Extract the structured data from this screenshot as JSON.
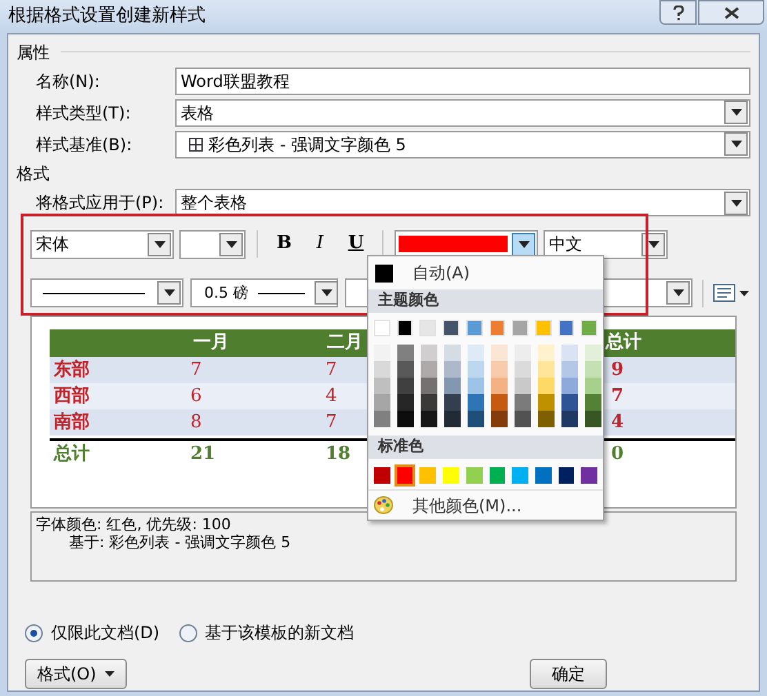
{
  "window": {
    "title": "根据格式设置创建新样式"
  },
  "properties": {
    "heading": "属性",
    "fields": [
      {
        "label": "名称(N):",
        "value": "Word联盟教程",
        "kind": "text"
      },
      {
        "label": "样式类型(T):",
        "value": "表格",
        "kind": "dropdown"
      },
      {
        "label": "样式基准(B):",
        "value": "彩色列表 - 强调文字颜色 5",
        "kind": "table_dropdown"
      }
    ]
  },
  "format": {
    "heading": "格式",
    "apply_label": "将格式应用于(P):",
    "apply_value": "整个表格",
    "font": "宋体",
    "style_buttons": [
      {
        "label": "B",
        "kind": "bold"
      },
      {
        "label": "I",
        "kind": "italic"
      },
      {
        "label": "U",
        "kind": "underline"
      }
    ],
    "font_color": {
      "color": "#ff0000"
    },
    "script": "中文",
    "line_weight": "0.5 磅"
  },
  "preview": {
    "columns": [
      "一月",
      "二月",
      "总计"
    ],
    "rows": [
      {
        "label": "东部",
        "values": [
          "7",
          "7",
          "9"
        ],
        "kind": "data"
      },
      {
        "label": "西部",
        "values": [
          "6",
          "4",
          "7"
        ],
        "kind": "data"
      },
      {
        "label": "南部",
        "values": [
          "8",
          "7",
          "4"
        ],
        "kind": "data"
      },
      {
        "label": "总计",
        "values": [
          "21",
          "18",
          "0"
        ],
        "kind": "total"
      }
    ]
  },
  "description": [
    "字体颜色: 红色, 优先级: 100",
    "基于: 彩色列表 - 强调文字颜色 5"
  ],
  "scope": [
    {
      "label": "仅限此文档(D)",
      "selected": true
    },
    {
      "label": "基于该模板的新文档",
      "selected": false
    }
  ],
  "buttons": {
    "format": "格式(O)",
    "ok": "确定"
  },
  "color_menu": {
    "auto_label": "自动(A)",
    "theme_heading": "主题颜色",
    "theme_colors": [
      {
        "color": "#ffffff",
        "selected": false,
        "shades": [
          {
            "color": "#f2f2f2"
          },
          {
            "color": "#d9d9d9"
          },
          {
            "color": "#bfbfbf"
          },
          {
            "color": "#a6a6a6"
          },
          {
            "color": "#808080"
          }
        ]
      },
      {
        "color": "#000000",
        "selected": false,
        "shades": [
          {
            "color": "#808080"
          },
          {
            "color": "#595959"
          },
          {
            "color": "#404040"
          },
          {
            "color": "#262626"
          },
          {
            "color": "#0d0d0d"
          }
        ]
      },
      {
        "color": "#e7e6e6",
        "selected": false,
        "shades": [
          {
            "color": "#d0cece"
          },
          {
            "color": "#aeaaaa"
          },
          {
            "color": "#757171"
          },
          {
            "color": "#3b3838"
          },
          {
            "color": "#171616"
          }
        ]
      },
      {
        "color": "#44546a",
        "selected": false,
        "shades": [
          {
            "color": "#d6dce4"
          },
          {
            "color": "#adb9ca"
          },
          {
            "color": "#8497b0"
          },
          {
            "color": "#333f4f"
          },
          {
            "color": "#222a35"
          }
        ]
      },
      {
        "color": "#5b9bd5",
        "selected": false,
        "shades": [
          {
            "color": "#deebf6"
          },
          {
            "color": "#bdd7ee"
          },
          {
            "color": "#9dc3e6"
          },
          {
            "color": "#2e75b5"
          },
          {
            "color": "#1f4e79"
          }
        ]
      },
      {
        "color": "#ed7d31",
        "selected": false,
        "shades": [
          {
            "color": "#fbe5d5"
          },
          {
            "color": "#f7cbac"
          },
          {
            "color": "#f4b183"
          },
          {
            "color": "#c55a11"
          },
          {
            "color": "#843c0b"
          }
        ]
      },
      {
        "color": "#a5a5a5",
        "selected": false,
        "shades": [
          {
            "color": "#ededed"
          },
          {
            "color": "#dbdbdb"
          },
          {
            "color": "#c9c9c9"
          },
          {
            "color": "#7b7b7b"
          },
          {
            "color": "#525252"
          }
        ]
      },
      {
        "color": "#ffc000",
        "selected": false,
        "shades": [
          {
            "color": "#fff2cc"
          },
          {
            "color": "#fee599"
          },
          {
            "color": "#ffd965"
          },
          {
            "color": "#bf9000"
          },
          {
            "color": "#7f6000"
          }
        ]
      },
      {
        "color": "#4472c4",
        "selected": false,
        "shades": [
          {
            "color": "#dae3f3"
          },
          {
            "color": "#b4c7e7"
          },
          {
            "color": "#8eaadb"
          },
          {
            "color": "#2f5496"
          },
          {
            "color": "#1f3864"
          }
        ]
      },
      {
        "color": "#70ad47",
        "selected": false,
        "shades": [
          {
            "color": "#e2efd9"
          },
          {
            "color": "#c5e0b3"
          },
          {
            "color": "#a8d08d"
          },
          {
            "color": "#538135"
          },
          {
            "color": "#375623"
          }
        ]
      }
    ],
    "standard_heading": "标准色",
    "standard_colors": [
      {
        "color": "#c00000",
        "selected": false
      },
      {
        "color": "#ff0000",
        "selected": true
      },
      {
        "color": "#ffc000",
        "selected": false
      },
      {
        "color": "#ffff00",
        "selected": false
      },
      {
        "color": "#92d050",
        "selected": false
      },
      {
        "color": "#00b050",
        "selected": false
      },
      {
        "color": "#00b0f0",
        "selected": false
      },
      {
        "color": "#0070c0",
        "selected": false
      },
      {
        "color": "#002060",
        "selected": false
      },
      {
        "color": "#7030a0",
        "selected": false
      }
    ],
    "more_label": "其他颜色(M)..."
  }
}
